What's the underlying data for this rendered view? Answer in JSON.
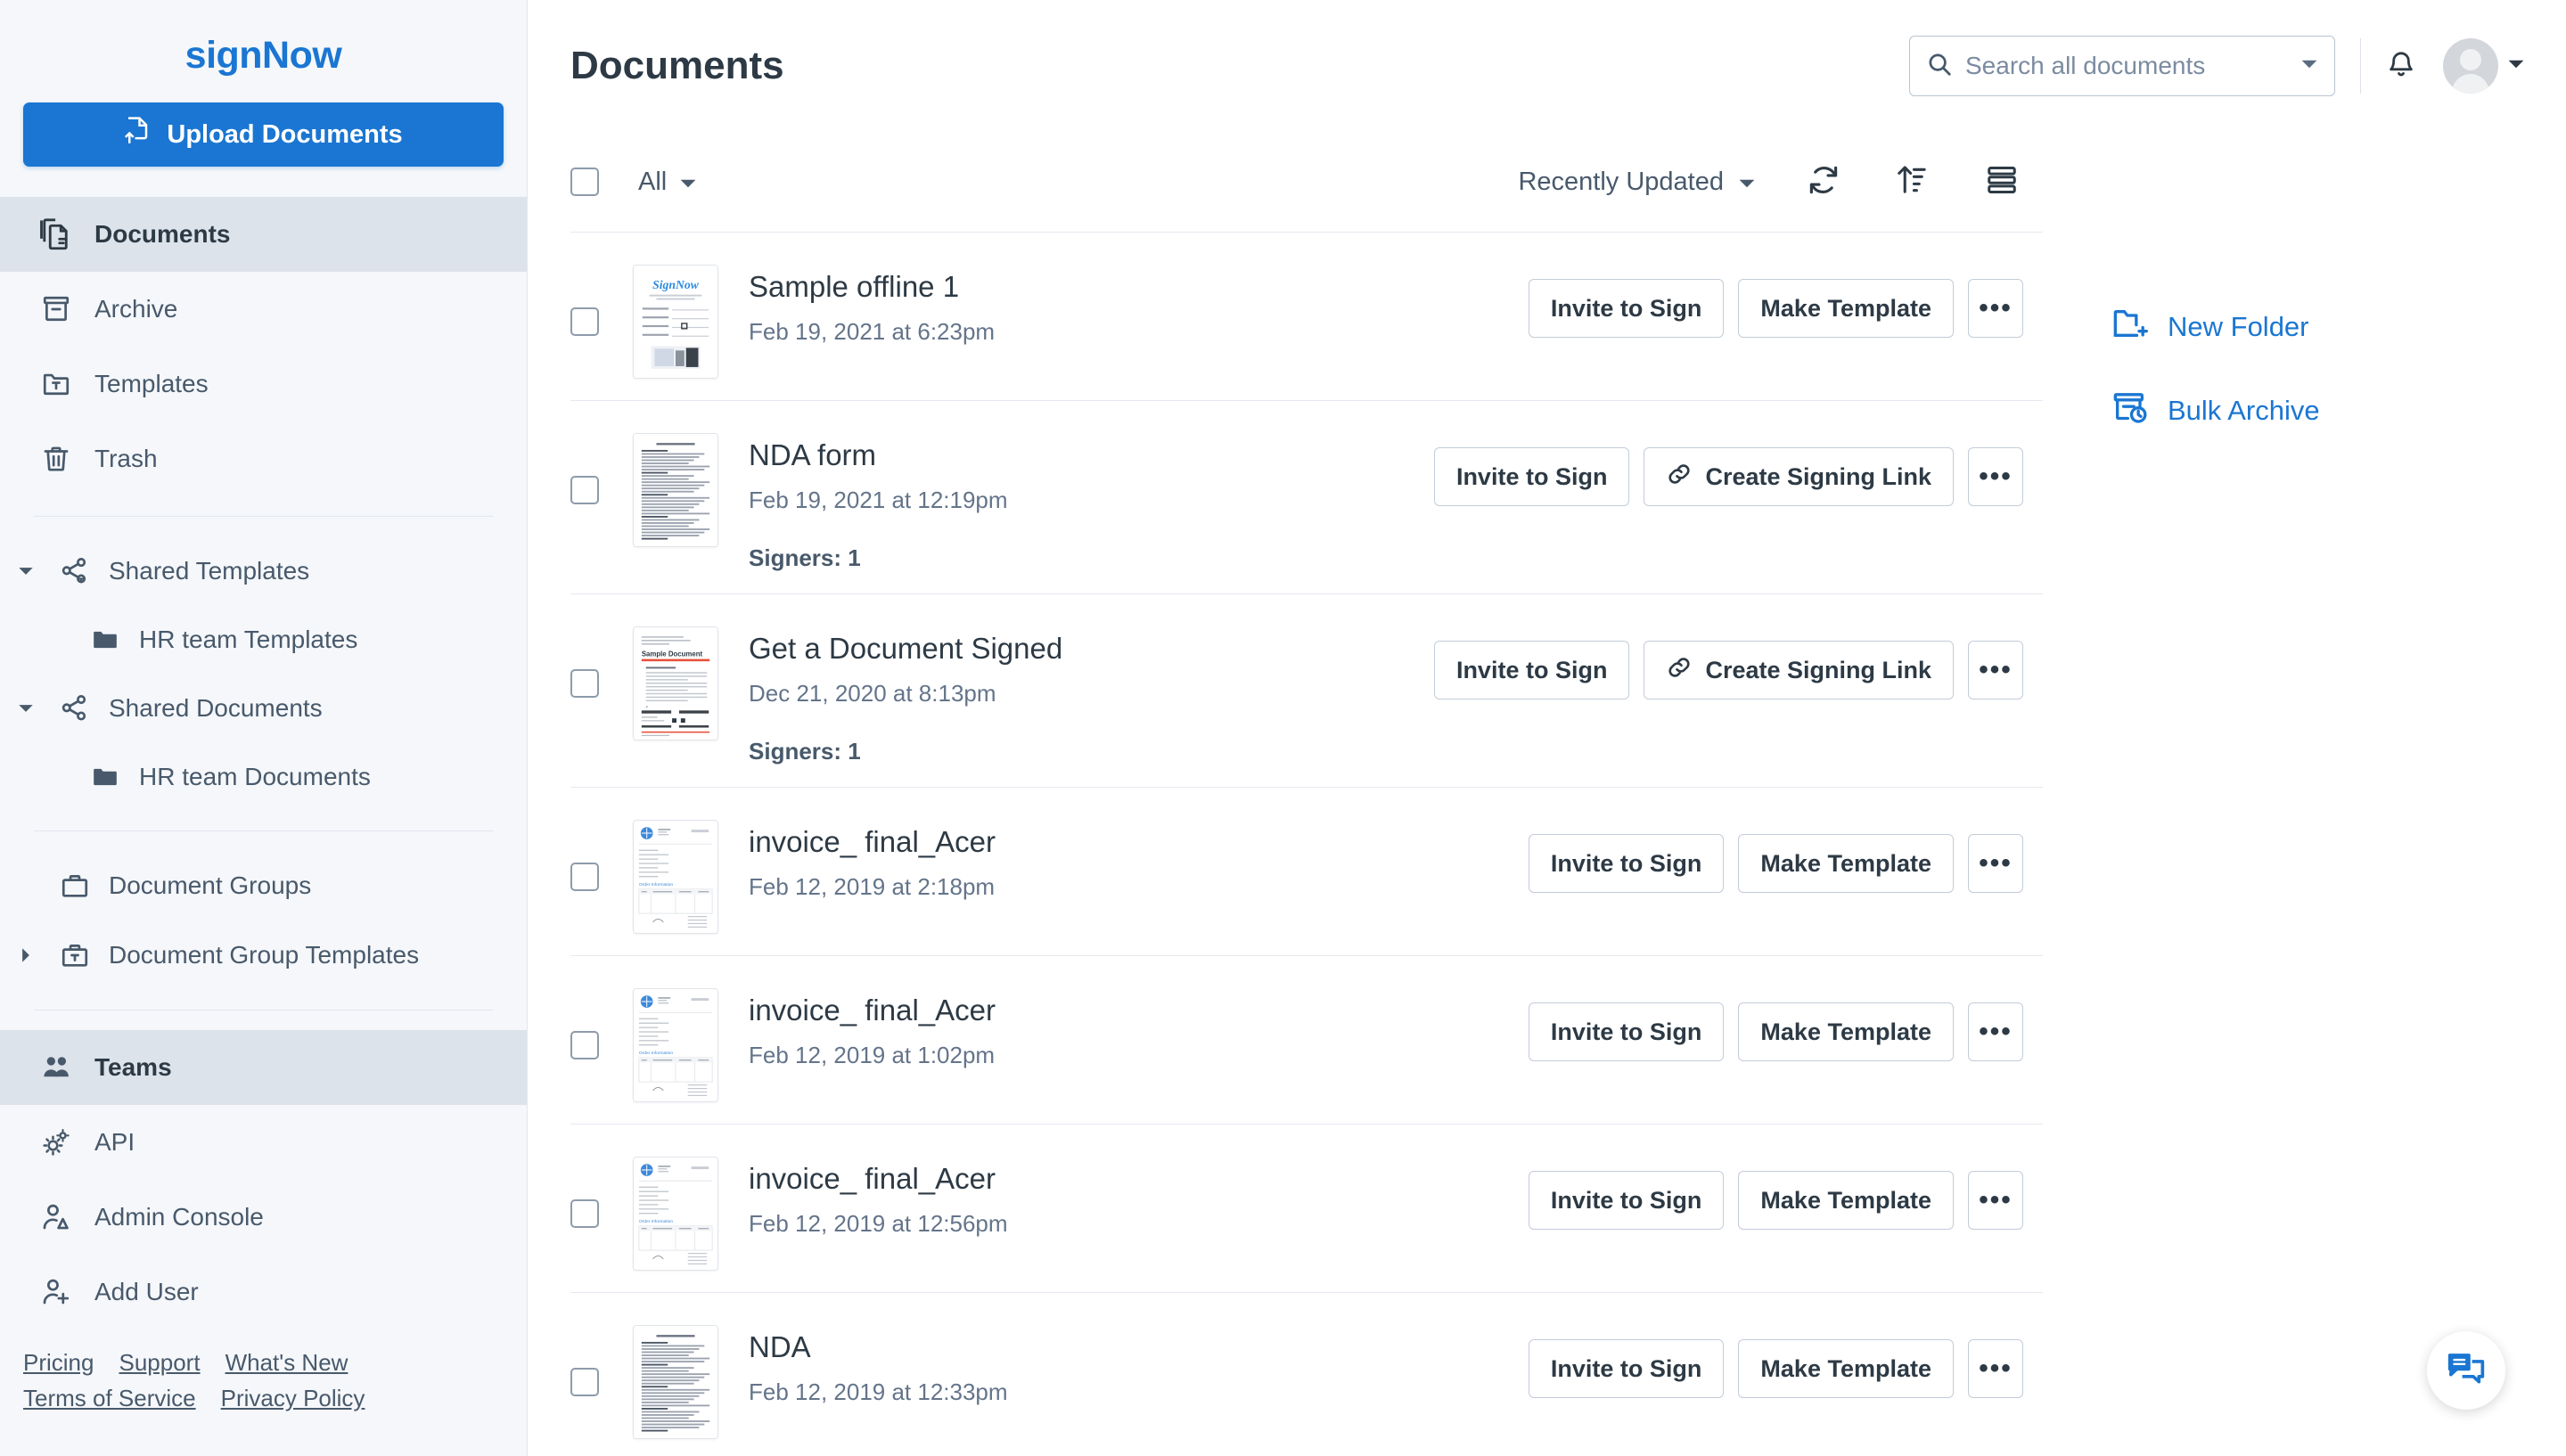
{
  "brand": {
    "name": "signNow",
    "color": "#1a76d2"
  },
  "upload": {
    "label": "Upload Documents",
    "icon": "upload-file-icon"
  },
  "sidebar": {
    "primary": [
      {
        "label": "Documents",
        "icon": "documents-icon",
        "active": true
      },
      {
        "label": "Archive",
        "icon": "archive-icon",
        "active": false
      },
      {
        "label": "Templates",
        "icon": "template-folder-icon",
        "active": false
      },
      {
        "label": "Trash",
        "icon": "trash-icon",
        "active": false
      }
    ],
    "trees": [
      {
        "label": "Shared Templates",
        "icon": "share-template-icon",
        "expanded": true,
        "children": [
          {
            "label": "HR team Templates",
            "icon": "folder-icon"
          }
        ]
      },
      {
        "label": "Shared Documents",
        "icon": "share-icon",
        "expanded": true,
        "children": [
          {
            "label": "HR team Documents",
            "icon": "folder-icon"
          }
        ]
      }
    ],
    "groups": [
      {
        "label": "Document Groups",
        "icon": "briefcase-icon",
        "expandable": false
      },
      {
        "label": "Document Group Templates",
        "icon": "briefcase-template-icon",
        "expandable": true,
        "expanded": false
      }
    ],
    "bottom": [
      {
        "label": "Teams",
        "icon": "teams-icon",
        "active": true
      },
      {
        "label": "API",
        "icon": "gears-icon",
        "active": false
      },
      {
        "label": "Admin Console",
        "icon": "user-admin-icon",
        "active": false
      },
      {
        "label": "Add User",
        "icon": "user-plus-icon",
        "active": false
      }
    ],
    "footer_links": [
      "Pricing",
      "Support",
      "What's New",
      "Terms of Service",
      "Privacy Policy"
    ]
  },
  "header": {
    "title": "Documents",
    "search": {
      "placeholder": "Search all documents",
      "value": "",
      "icon": "search-icon",
      "dropdown_icon": "chevron-down-icon"
    },
    "notifications_icon": "bell-icon",
    "avatar_icon": "avatar",
    "avatar_dropdown_icon": "chevron-down-icon"
  },
  "toolbar": {
    "select_all_checked": false,
    "filter_label": "All",
    "sort_label": "Recently Updated",
    "refresh_icon": "refresh-icon",
    "sort_icon": "sort-ascending-icon",
    "view_icon": "list-view-icon"
  },
  "side_actions": [
    {
      "label": "New Folder",
      "icon": "new-folder-icon"
    },
    {
      "label": "Bulk Archive",
      "icon": "bulk-archive-icon"
    }
  ],
  "buttons": {
    "invite_to_sign": "Invite to Sign",
    "make_template": "Make Template",
    "create_signing_link": "Create Signing Link",
    "more": "•••",
    "link_icon": "link-icon"
  },
  "documents": [
    {
      "name": "Sample offline 1",
      "date": "Feb 19, 2021 at 6:23pm",
      "signers": "",
      "thumb": "signnow-offline",
      "actions": [
        "invite",
        "template",
        "more"
      ]
    },
    {
      "name": "NDA form",
      "date": "Feb 19, 2021 at 12:19pm",
      "signers": "Signers: 1",
      "thumb": "text-doc",
      "actions": [
        "invite",
        "link",
        "more"
      ]
    },
    {
      "name": "Get a Document Signed",
      "date": "Dec 21, 2020 at 8:13pm",
      "signers": "Signers: 1",
      "thumb": "sample-document",
      "actions": [
        "invite",
        "link",
        "more"
      ]
    },
    {
      "name": "invoice_ final_Acer",
      "date": "Feb 12, 2019 at 2:18pm",
      "signers": "",
      "thumb": "invoice",
      "actions": [
        "invite",
        "template",
        "more"
      ]
    },
    {
      "name": "invoice_ final_Acer",
      "date": "Feb 12, 2019 at 1:02pm",
      "signers": "",
      "thumb": "invoice",
      "actions": [
        "invite",
        "template",
        "more"
      ]
    },
    {
      "name": "invoice_ final_Acer",
      "date": "Feb 12, 2019 at 12:56pm",
      "signers": "",
      "thumb": "invoice",
      "actions": [
        "invite",
        "template",
        "more"
      ]
    },
    {
      "name": "NDA",
      "date": "Feb 12, 2019 at 12:33pm",
      "signers": "",
      "thumb": "text-doc",
      "actions": [
        "invite",
        "template",
        "more"
      ]
    }
  ],
  "chat": {
    "icon": "chat-bubble-icon"
  }
}
